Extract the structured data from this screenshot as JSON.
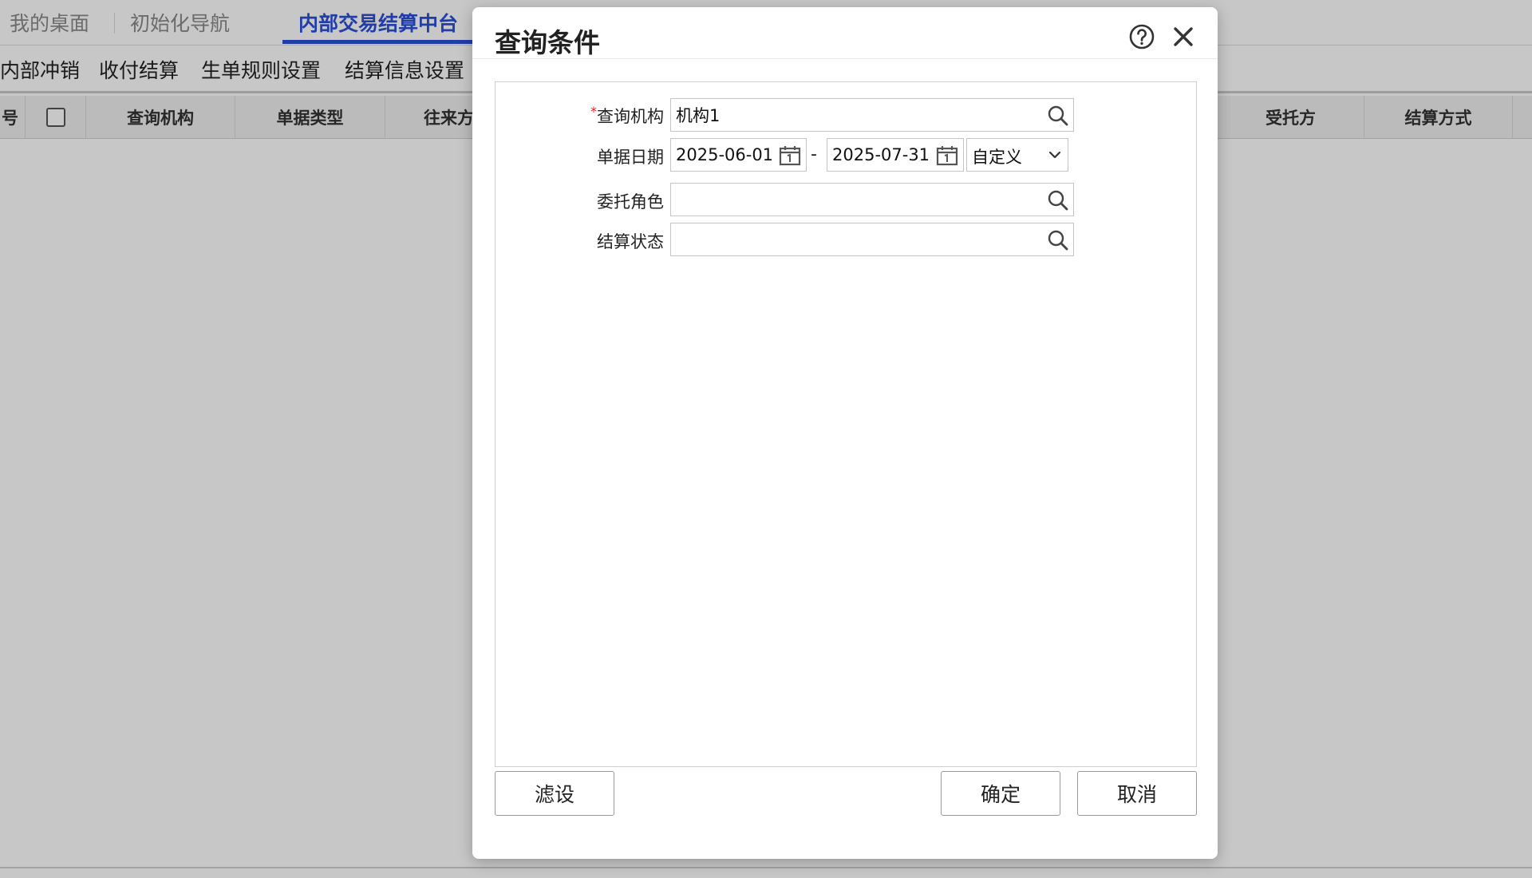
{
  "app": {
    "tabs": [
      {
        "label": "我的桌面"
      },
      {
        "label": "初始化导航"
      },
      {
        "label": "内部交易结算中台"
      }
    ],
    "menu": [
      {
        "label": "内部冲销"
      },
      {
        "label": "收付结算"
      },
      {
        "label": "生单规则设置"
      },
      {
        "label": "结算信息设置"
      }
    ],
    "grid_columns": {
      "index": "号",
      "org": "查询机构",
      "doc_type": "单据类型",
      "counterparty": "往来方",
      "trustee": "受托方",
      "settle_method": "结算方式"
    }
  },
  "dialog": {
    "title": "查询条件",
    "fields": {
      "query_org": {
        "required_mark": "*",
        "label": "查询机构",
        "value": "机构1"
      },
      "doc_date": {
        "label": "单据日期",
        "start": "2025-06-01",
        "separator": "-",
        "end": "2025-07-31",
        "range_option": "自定义"
      },
      "entrust_role": {
        "label": "委托角色",
        "value": ""
      },
      "settle_status": {
        "label": "结算状态",
        "value": ""
      }
    },
    "buttons": {
      "filter": "滤设",
      "confirm": "确定",
      "cancel": "取消"
    }
  },
  "colors": {
    "accent": "#2b4fd8",
    "required": "#e02020",
    "overlay": "rgba(0,0,0,0.22)"
  },
  "icons": {
    "help": "help-circle-icon",
    "close": "close-icon",
    "search": "search-icon",
    "calendar": "calendar-icon",
    "dropdown": "chevron-down-icon"
  }
}
